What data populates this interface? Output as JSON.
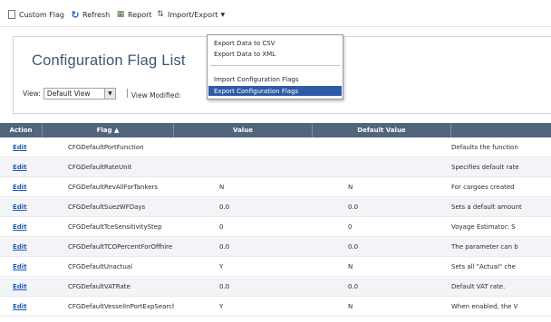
{
  "toolbar": {
    "custom_flag": "Custom Flag",
    "refresh": "Refresh",
    "report": "Report",
    "import_export": "Import/Export",
    "import_export_arrow": "▼"
  },
  "header": {
    "title": "Configuration Flag List",
    "view_label": "View:",
    "view_value": "Default View",
    "view_modified": "View Modified:"
  },
  "menu": {
    "items": [
      {
        "label": "Export Data to CSV",
        "selected": false
      },
      {
        "label": "Export Data to XML",
        "selected": false
      },
      {
        "label": "Import Configuration Flags",
        "selected": false
      },
      {
        "label": "Export Configuration Flags",
        "selected": true
      }
    ]
  },
  "grid": {
    "columns": [
      "Action",
      "Flag ▲",
      "Value",
      "Default Value",
      ""
    ],
    "rows": [
      {
        "action": "Edit",
        "flag": "CFGDefaultPortFunction",
        "value": "",
        "default": "",
        "desc": "Defaults the function"
      },
      {
        "action": "Edit",
        "flag": "CFGDefaultRateUnit",
        "value": "",
        "default": "",
        "desc": "Specifies default rate"
      },
      {
        "action": "Edit",
        "flag": "CFGDefaultRevAllForTankers",
        "value": "N",
        "default": "N",
        "desc": "For cargoes created"
      },
      {
        "action": "Edit",
        "flag": "CFGDefaultSuezWFDays",
        "value": "0.0",
        "default": "0.0",
        "desc": "Sets a default amount"
      },
      {
        "action": "Edit",
        "flag": "CFGDefaultTceSensitivityStep",
        "value": "0",
        "default": "0",
        "desc": "Voyage Estimator: S"
      },
      {
        "action": "Edit",
        "flag": "CFGDefaultTCOPercentForOffhire",
        "value": "0.0",
        "default": "0.0",
        "desc": "The parameter can b"
      },
      {
        "action": "Edit",
        "flag": "CFGDefaultUnactual",
        "value": "Y",
        "default": "N",
        "desc": "Sets all \"Actual\" che"
      },
      {
        "action": "Edit",
        "flag": "CFGDefaultVATRate",
        "value": "0.0",
        "default": "0.0",
        "desc": "Default VAT rate."
      },
      {
        "action": "Edit",
        "flag": "CFGDefaultVesselInPortExpSearch",
        "value": "Y",
        "default": "N",
        "desc": "When enabled, the V"
      }
    ]
  },
  "colors": {
    "header_bg": "#51657d",
    "link": "#2559b4",
    "menu_selected": "#2f5aa6",
    "title": "#3e5773"
  },
  "icons": [
    "custom-flag-icon",
    "refresh-icon",
    "report-icon",
    "import-export-icon",
    "dropdown-arrow-icon"
  ]
}
